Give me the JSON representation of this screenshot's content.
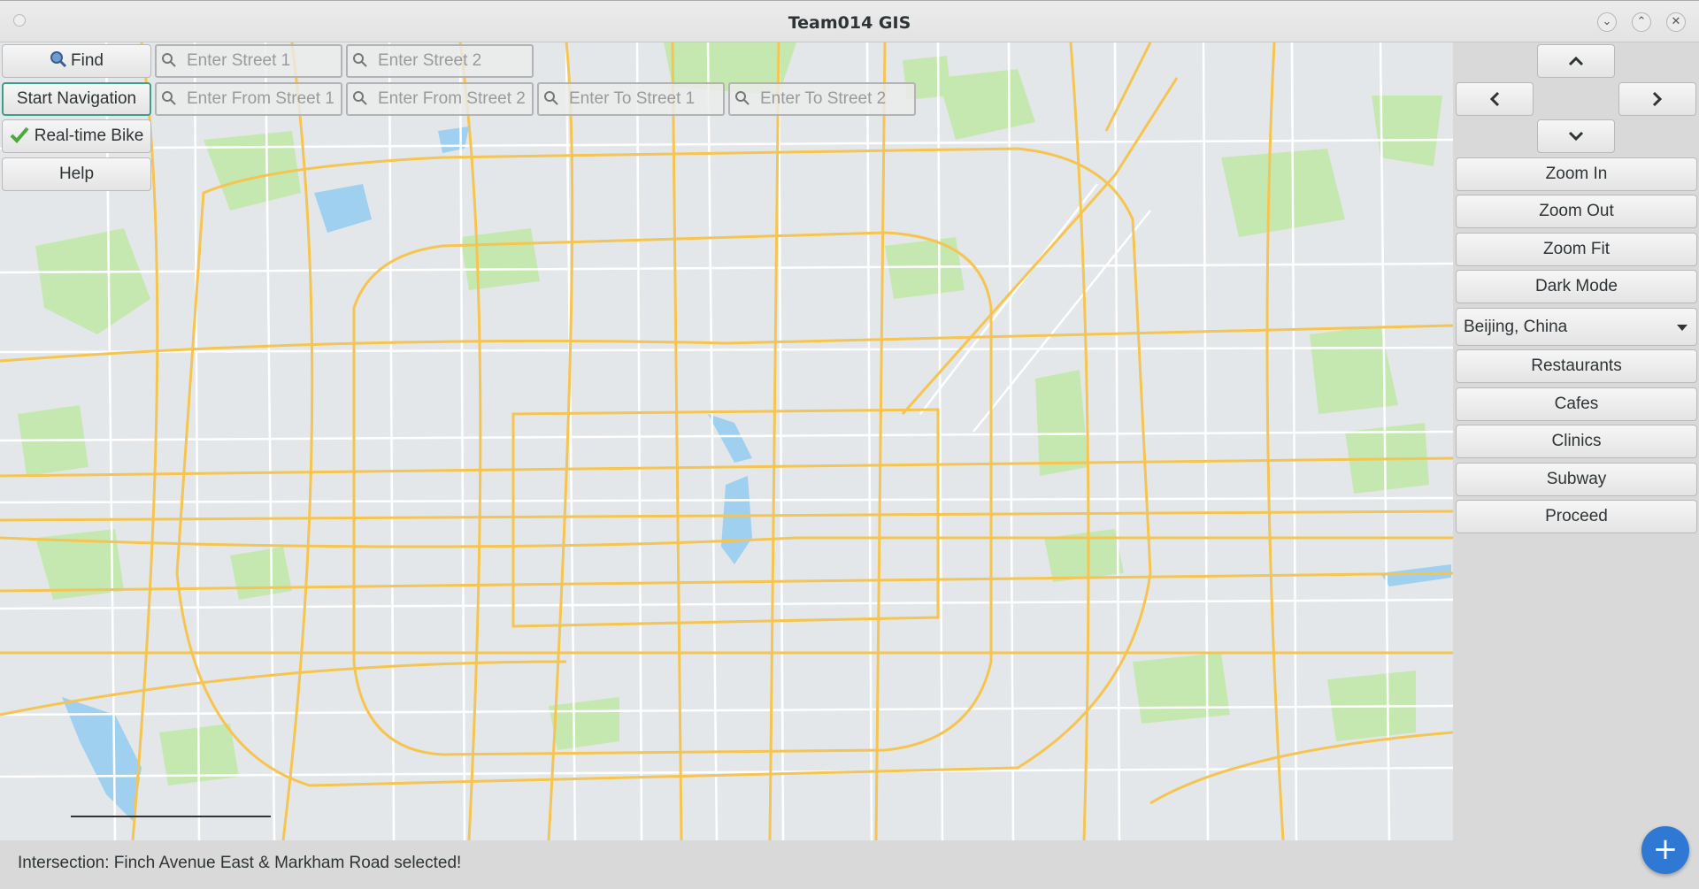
{
  "window": {
    "title": "Team014 GIS"
  },
  "toolbar": {
    "find_label": "Find",
    "start_nav_label": "Start Navigation",
    "realtime_bike_label": "Real-time Bike",
    "help_label": "Help",
    "street1_placeholder": "Enter Street 1",
    "street2_placeholder": "Enter Street 2",
    "from_street1_placeholder": "Enter From Street 1",
    "from_street2_placeholder": "Enter From Street 2",
    "to_street1_placeholder": "Enter To Street 1",
    "to_street2_placeholder": "Enter To Street 2"
  },
  "sidebar": {
    "zoom_in": "Zoom In",
    "zoom_out": "Zoom Out",
    "zoom_fit": "Zoom Fit",
    "dark_mode": "Dark Mode",
    "city_selected": "Beijing, China",
    "restaurants": "Restaurants",
    "cafes": "Cafes",
    "clinics": "Clinics",
    "subway": "Subway",
    "proceed": "Proceed"
  },
  "status": {
    "message": "Intersection: Finch Avenue East & Markham Road selected!"
  },
  "colors": {
    "map_bg": "#e4e7e9",
    "road_major": "#f5c451",
    "road_minor": "#ffffff",
    "park": "#c5e8b0",
    "water": "#9fd0f0",
    "accent": "#2f78d4"
  }
}
